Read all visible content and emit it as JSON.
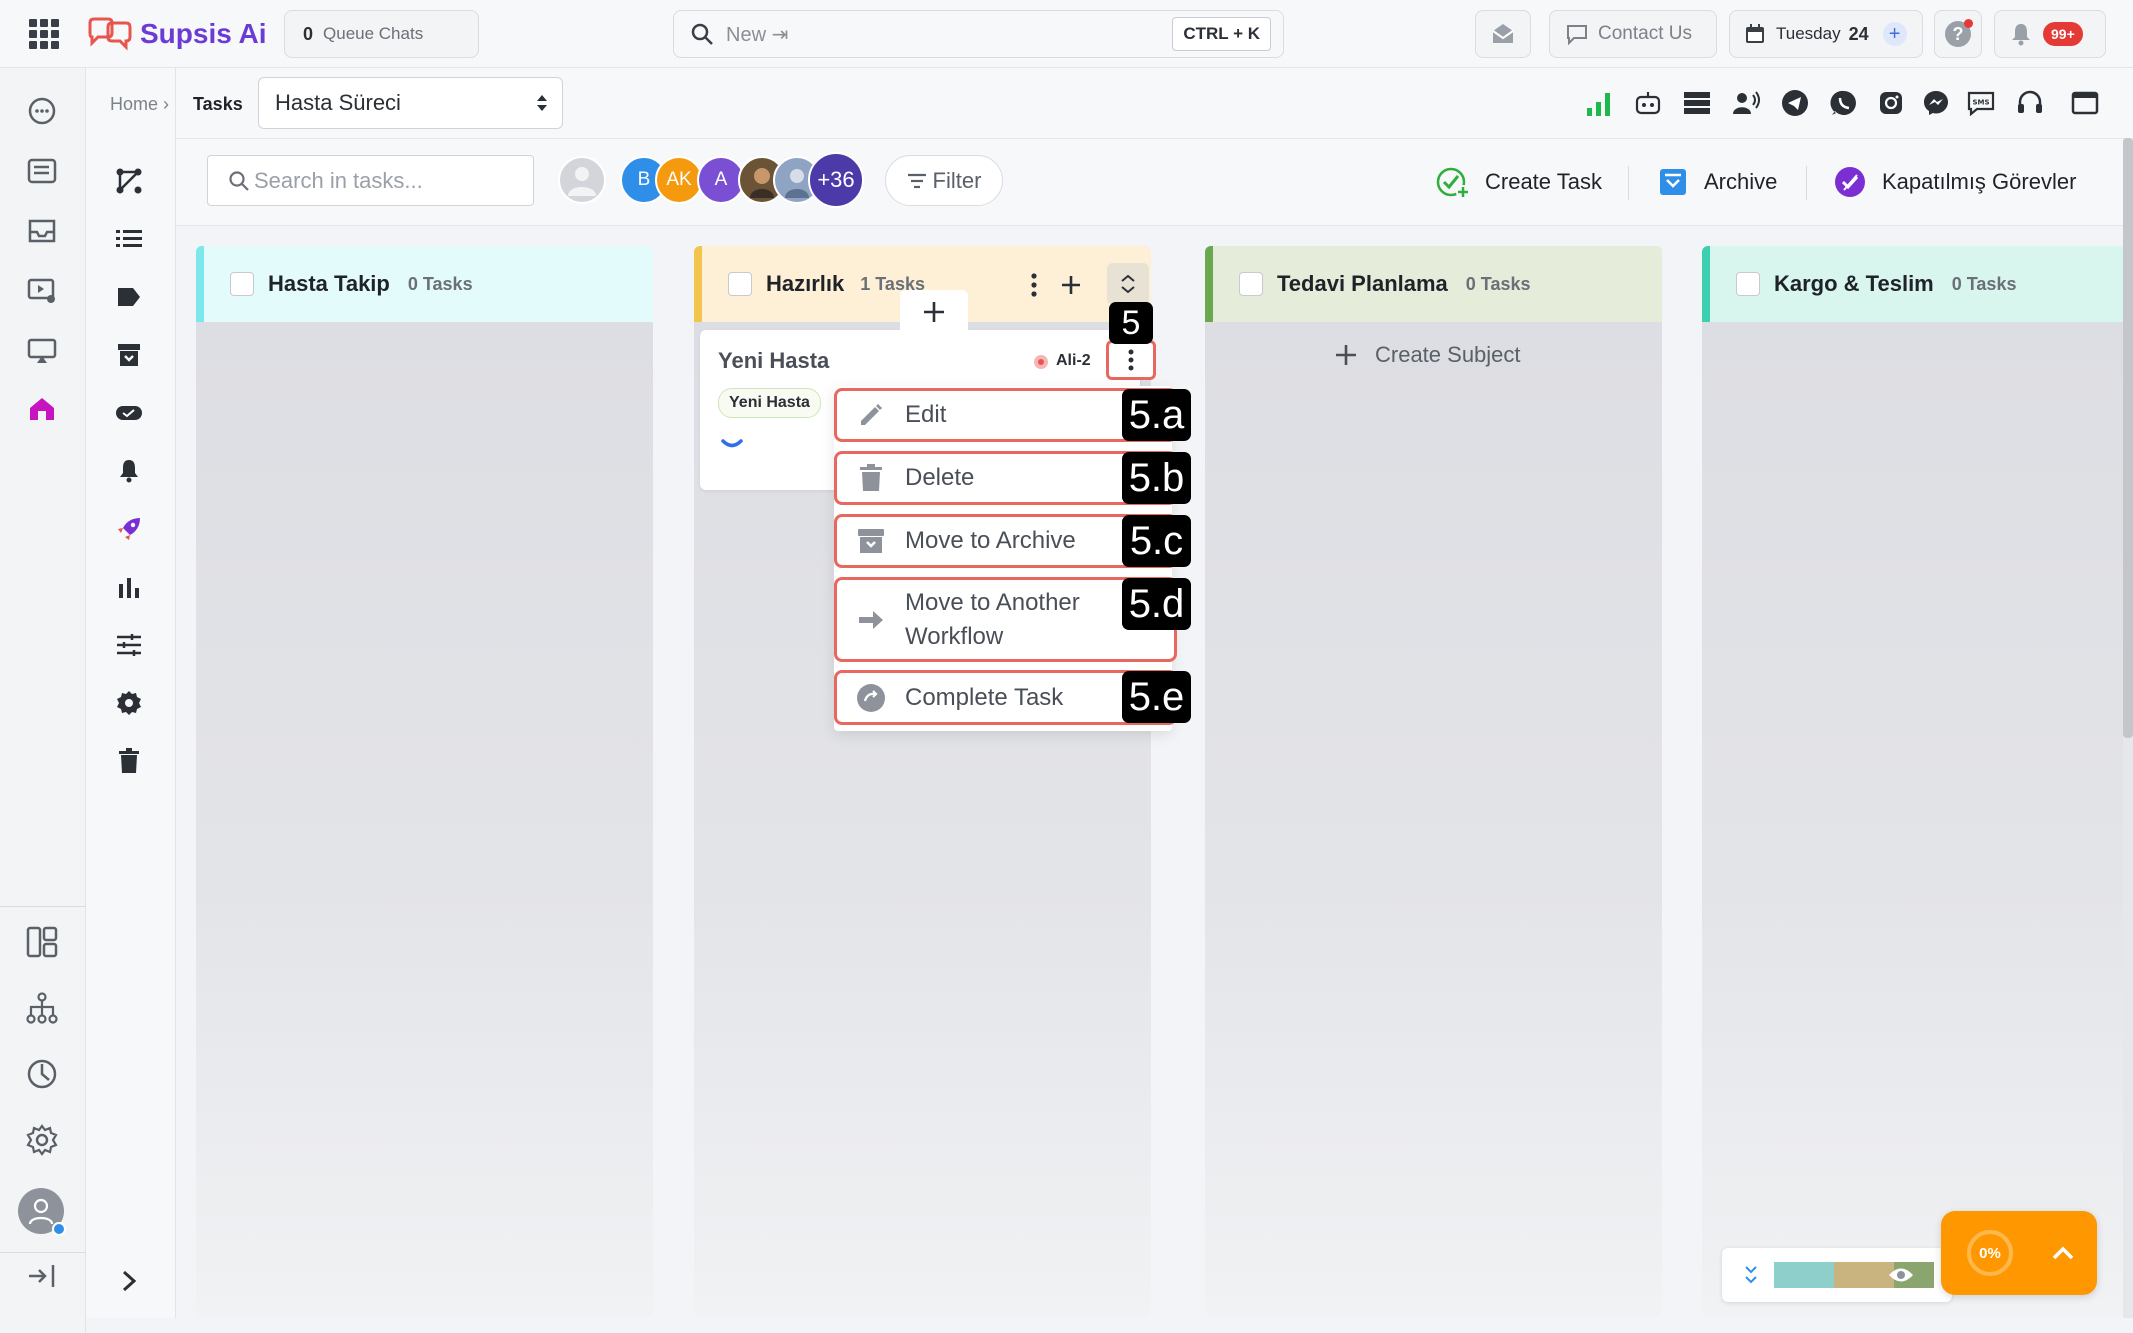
{
  "app": {
    "name": "Supsis Ai"
  },
  "topbar": {
    "queue_count": "0",
    "queue_label": "Queue Chats",
    "search_placeholder": "New ⇥",
    "shortcut": "CTRL + K",
    "contact_label": "Contact Us",
    "date_day": "Tuesday",
    "date_num": "24",
    "notif_badge": "99+"
  },
  "breadcrumb": {
    "home": "Home ›",
    "current": "Tasks",
    "workflow_select": "Hasta Süreci"
  },
  "toolbar": {
    "search_placeholder": "Search in tasks...",
    "avatars": [
      {
        "initials": "B",
        "color": "#2f8fe8"
      },
      {
        "initials": "AK",
        "color": "#f59a0e"
      },
      {
        "initials": "A",
        "color": "#7b4fd3"
      }
    ],
    "more_count": "+36",
    "filter_label": "Filter",
    "create_task": "Create Task",
    "archive": "Archive",
    "closed_tasks": "Kapatılmış Görevler"
  },
  "columns": [
    {
      "title": "Hasta Takip",
      "count": "0 Tasks",
      "accent": "#7de8ec",
      "bg": "#e3fbfb"
    },
    {
      "title": "Hazırlık",
      "count": "1 Tasks",
      "accent": "#f3c54d",
      "bg": "#fdf0d6"
    },
    {
      "title": "Tedavi Planlama",
      "count": "0 Tasks",
      "accent": "#6aa84f",
      "bg": "#e5ecd9",
      "create_subject": "Create Subject"
    },
    {
      "title": "Kargo & Teslim",
      "count": "0 Tasks",
      "accent": "#3ccfb0",
      "bg": "#d8f5ee"
    }
  ],
  "task_card": {
    "title": "Yeni Hasta",
    "tag": "Yeni Hasta",
    "assignee": "Ali-2"
  },
  "context_menu": [
    {
      "label": "Edit",
      "badge": "5.a"
    },
    {
      "label": "Delete",
      "badge": "5.b"
    },
    {
      "label": "Move to Archive",
      "badge": "5.c"
    },
    {
      "label": "Move to Another Workflow",
      "badge": "5.d"
    },
    {
      "label": "Complete Task",
      "badge": "5.e"
    }
  ],
  "menu_badge": "5",
  "progress": {
    "label": "0%",
    "value": 0
  },
  "colors": {
    "accent_purple": "#7b2fd3",
    "brand_red": "#e8554e",
    "annotation": "#e8675f"
  }
}
